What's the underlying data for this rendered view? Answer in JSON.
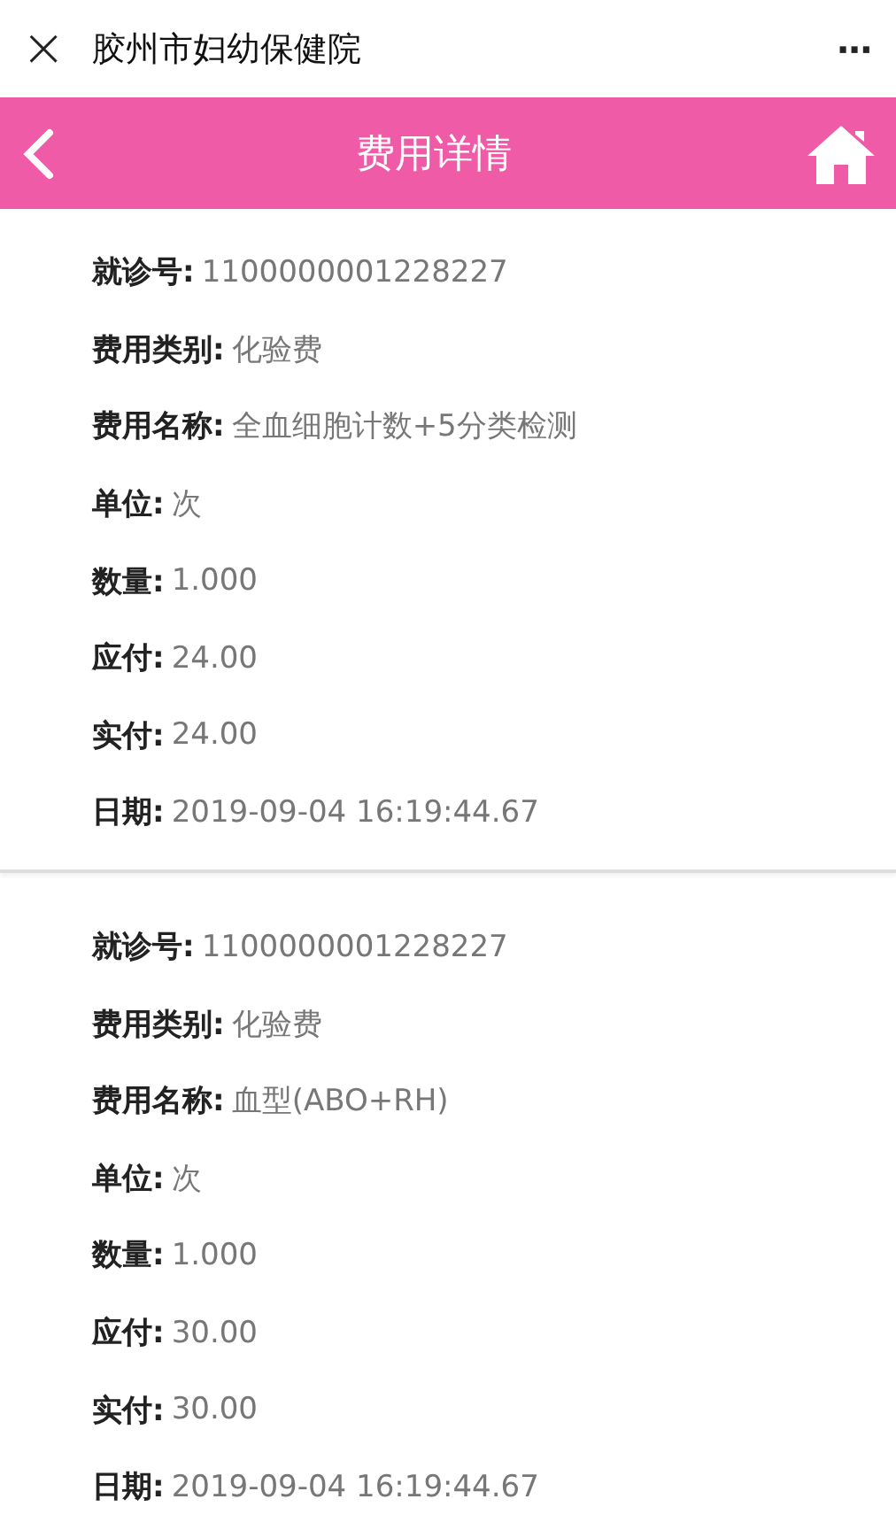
{
  "top_bar": {
    "close": "×",
    "title": "胶州市妇幼保健院",
    "more": "···"
  },
  "nav_bar": {
    "title": "费用详情"
  },
  "records": [
    {
      "fields": [
        {
          "label": "就诊号:",
          "value": "1100000001228227"
        },
        {
          "label": "费用类别:",
          "value": "化验费"
        },
        {
          "label": "费用名称:",
          "value": "全血细胞计数+5分类检测"
        },
        {
          "label": "单位:",
          "value": "次"
        },
        {
          "label": "数量:",
          "value": "1.000"
        },
        {
          "label": "应付:",
          "value": "24.00"
        },
        {
          "label": "实付:",
          "value": "24.00"
        },
        {
          "label": "日期:",
          "value": "2019-09-04 16:19:44.67"
        }
      ]
    },
    {
      "fields": [
        {
          "label": "就诊号:",
          "value": "1100000001228227"
        },
        {
          "label": "费用类别:",
          "value": "化验费"
        },
        {
          "label": "费用名称:",
          "value": "血型(ABO+RH)"
        },
        {
          "label": "单位:",
          "value": "次"
        },
        {
          "label": "数量:",
          "value": "1.000"
        },
        {
          "label": "应付:",
          "value": "30.00"
        },
        {
          "label": "实付:",
          "value": "30.00"
        },
        {
          "label": "日期:",
          "value": "2019-09-04 16:19:44.67"
        }
      ]
    }
  ]
}
